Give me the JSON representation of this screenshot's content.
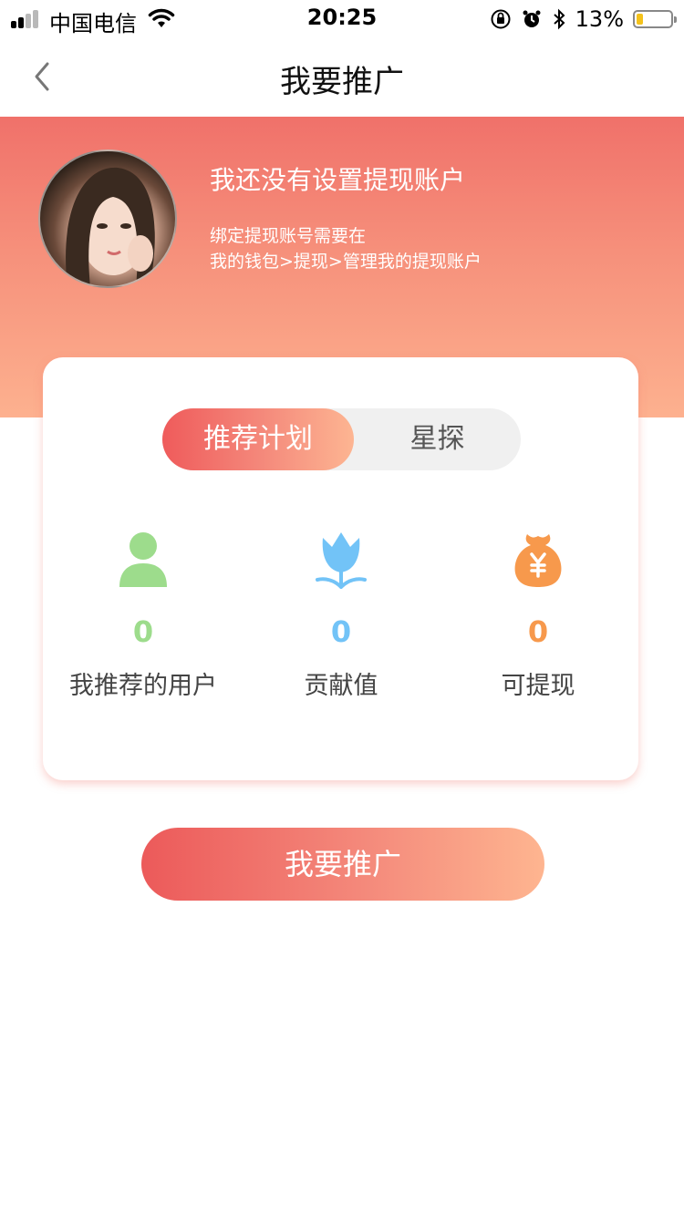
{
  "status_bar": {
    "carrier": "中国电信",
    "time": "20:25",
    "battery_percent": "13%",
    "battery_level": 0.13,
    "icons": [
      "signal-icon",
      "wifi-icon",
      "orientation-lock-icon",
      "alarm-icon",
      "bluetooth-icon",
      "battery-icon"
    ]
  },
  "nav": {
    "title": "我要推广",
    "back_icon": "chevron-left-icon"
  },
  "header": {
    "title": "我还没有设置提现账户",
    "desc_line1": "绑定提现账号需要在",
    "desc_line2": "我的钱包>提现>管理我的提现账户"
  },
  "card": {
    "tabs": [
      {
        "label": "推荐计划",
        "active": true
      },
      {
        "label": "星探",
        "active": false
      }
    ],
    "stats": [
      {
        "icon": "user-icon",
        "value": "0",
        "label": "我推荐的用户",
        "color": "#9ddc8c"
      },
      {
        "icon": "tulip-icon",
        "value": "0",
        "label": "贡献值",
        "color": "#72c3f7"
      },
      {
        "icon": "money-bag-icon",
        "value": "0",
        "label": "可提现",
        "color": "#f7994c"
      }
    ]
  },
  "primary_button": {
    "label": "我要推广"
  },
  "colors": {
    "header_gradient_top": "#f0716a",
    "header_gradient_bottom": "#fdb18f",
    "accent_start": "#ec5a5a",
    "accent_end": "#feb590"
  }
}
